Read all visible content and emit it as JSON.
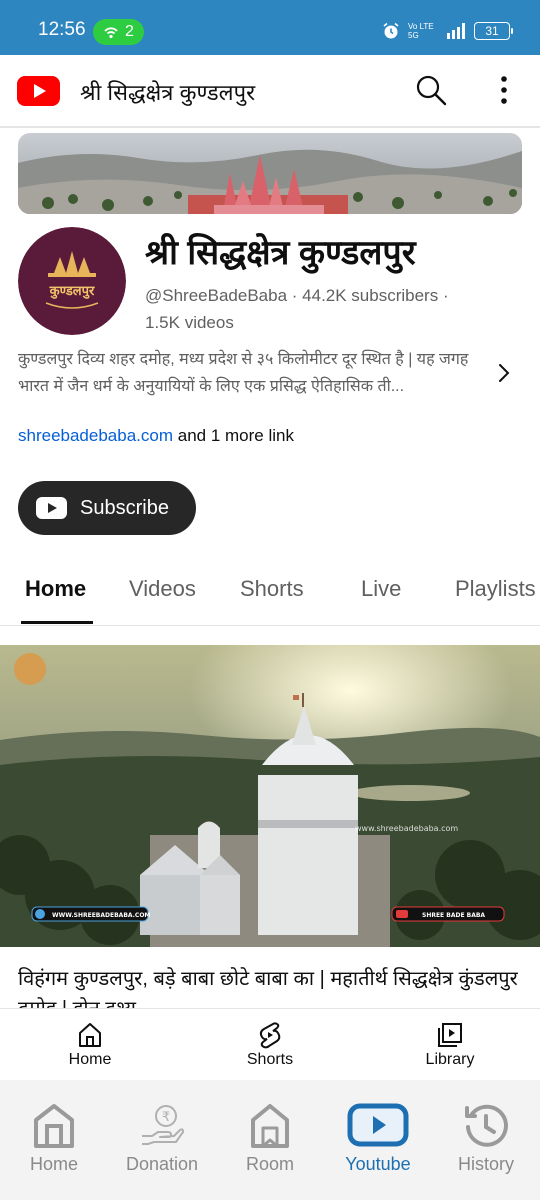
{
  "status_bar": {
    "time": "12:56",
    "hotspot_count": "2",
    "network": "Vo LTE 5G",
    "battery": "31"
  },
  "app_bar": {
    "title": "श्री सिद्धक्षेत्र कुण्डलपुर",
    "icons": [
      "youtube-logo",
      "search-icon",
      "more-vert-icon"
    ]
  },
  "channel": {
    "name": "श्री सिद्धक्षेत्र कुण्डलपुर",
    "avatar_text": "कुण्डलपुर",
    "handle": "@ShreeBadeBaba",
    "subscribers": "44.2K subscribers",
    "videos": "1.5K videos",
    "description": "कुण्डलपुर दिव्य शहर दमोह, मध्य प्रदेश से ३५ किलोमीटर दूर स्थित है | यह जगह भारत में जैन धर्म के अनुयायियों के लिए एक प्रसिद्ध ऐतिहासिक ती...",
    "link": "shreebadebaba.com",
    "more_links": "and 1 more link",
    "subscribe_label": "Subscribe"
  },
  "tabs": [
    {
      "label": "Home",
      "active": true
    },
    {
      "label": "Videos",
      "active": false
    },
    {
      "label": "Shorts",
      "active": false
    },
    {
      "label": "Live",
      "active": false
    },
    {
      "label": "Playlists",
      "active": false
    }
  ],
  "featured_video": {
    "watermark_site": "www.shreebadebaba.com",
    "watermark_url": "WWW.SHREEBADEBABA.COM",
    "watermark_name": "SHREE BADE BABA",
    "title": "विहंगम कुण्डलपुर, बड़े बाबा छोटे बाबा का | महातीर्थ सिद्धक्षेत्र कुंडलपुर दमोह | ड्रोन दृश्य"
  },
  "youtube_nav": [
    {
      "label": "Home",
      "icon": "home-icon"
    },
    {
      "label": "Shorts",
      "icon": "shorts-icon"
    },
    {
      "label": "Library",
      "icon": "library-icon"
    }
  ],
  "app_nav": [
    {
      "label": "Home",
      "icon": "temple-home-icon",
      "active": false
    },
    {
      "label": "Donation",
      "icon": "donation-icon",
      "active": false
    },
    {
      "label": "Room",
      "icon": "room-icon",
      "active": false
    },
    {
      "label": "Youtube",
      "icon": "youtube-icon",
      "active": true
    },
    {
      "label": "History",
      "icon": "history-icon",
      "active": false
    }
  ],
  "colors": {
    "status_bar": "#2e86c1",
    "hotspot": "#2ecc40",
    "youtube_red": "#ff0000",
    "link_blue": "#065fd4",
    "active_nav": "#1e6fb2"
  }
}
